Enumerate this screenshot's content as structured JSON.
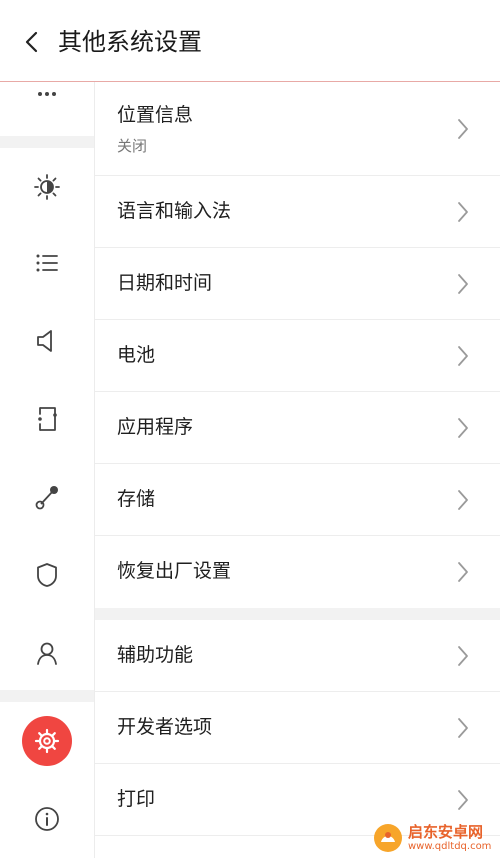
{
  "header": {
    "title": "其他系统设置"
  },
  "list": [
    {
      "label": "位置信息",
      "sub": "关闭"
    },
    {
      "label": "语言和输入法"
    },
    {
      "label": "日期和时间"
    },
    {
      "label": "电池"
    },
    {
      "label": "应用程序"
    },
    {
      "label": "存储"
    },
    {
      "label": "恢复出厂设置"
    },
    {
      "label": "辅助功能"
    },
    {
      "label": "开发者选项"
    },
    {
      "label": "打印"
    }
  ],
  "sidebar": {
    "icons": [
      "more-icon",
      "brightness-icon",
      "list-icon",
      "volume-icon",
      "notes-icon",
      "connection-icon",
      "shield-icon",
      "user-icon",
      "gear-icon",
      "info-icon"
    ],
    "active_color": "#f04641"
  },
  "watermark": {
    "cn": "启东安卓网",
    "en": "www.qdltdq.com"
  }
}
